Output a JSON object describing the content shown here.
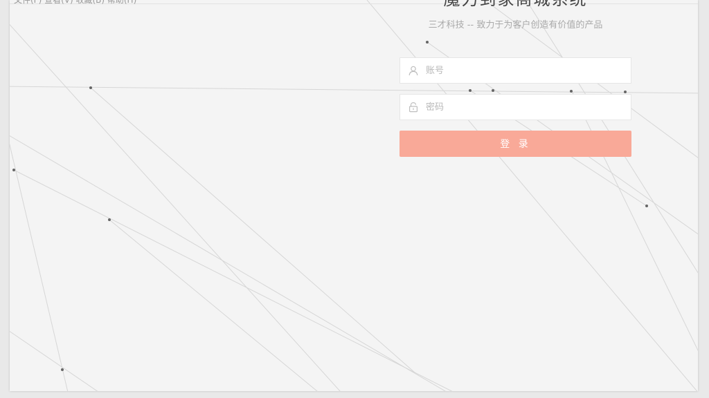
{
  "menu": {
    "text": "文件(F)  查看(V)  收藏(B)  帮助(H)"
  },
  "login": {
    "title": "魔力到家商城系统",
    "subtitle": "三才科技 -- 致力于为客户创造有价值的产品",
    "account_placeholder": "账号",
    "password_placeholder": "密码",
    "submit_label": "登 录"
  },
  "colors": {
    "page_background": "#f4f4f4",
    "button": "#f9a998",
    "line": "#d6d6d6",
    "dot": "#666666"
  },
  "icons": {
    "account": "user-icon",
    "password": "lock-icon"
  }
}
